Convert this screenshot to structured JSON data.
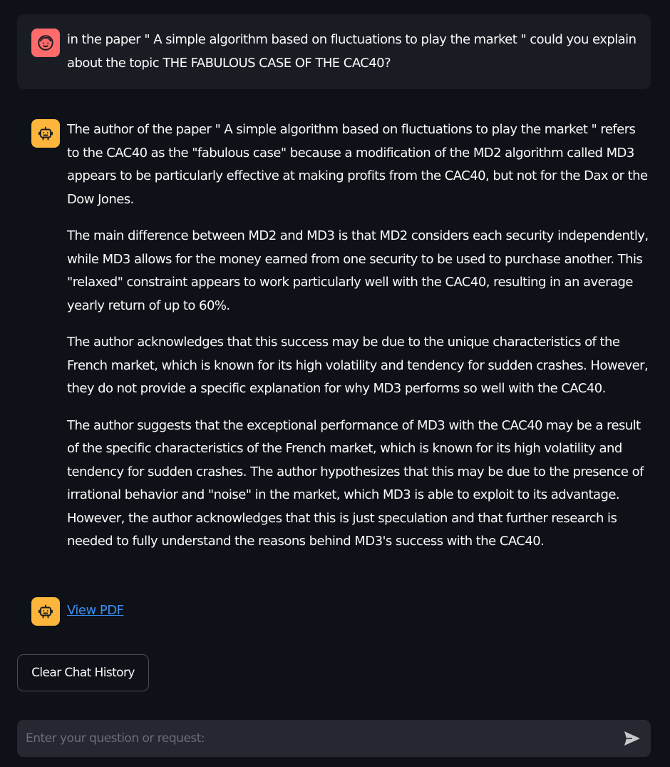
{
  "user_message": {
    "icon": "user-face-icon",
    "text": "in the paper \" A simple algorithm based on fluctuations to play the market \" could you explain about the topic THE FABULOUS CASE OF THE CAC40?"
  },
  "assistant_message": {
    "icon": "robot-icon",
    "paragraphs": [
      "The author of the paper \" A simple algorithm based on fluctuations to play the market \" refers to the CAC40 as the \"fabulous case\" because a modification of the MD2 algorithm called MD3 appears to be particularly effective at making profits from the CAC40, but not for the Dax or the Dow Jones.",
      "The main difference between MD2 and MD3 is that MD2 considers each security independently, while MD3 allows for the money earned from one security to be used to purchase another. This \"relaxed\" constraint appears to work particularly well with the CAC40, resulting in an average yearly return of up to 60%.",
      "The author acknowledges that this success may be due to the unique characteristics of the French market, which is known for its high volatility and tendency for sudden crashes. However, they do not provide a specific explanation for why MD3 performs so well with the CAC40.",
      "The author suggests that the exceptional performance of MD3 with the CAC40 may be a result of the specific characteristics of the French market, which is known for its high volatility and tendency for sudden crashes. The author hypothesizes that this may be due to the presence of irrational behavior and \"noise\" in the market, which MD3 is able to exploit to its advantage. However, the author acknowledges that this is just speculation and that further research is needed to fully understand the reasons behind MD3's success with the CAC40."
    ]
  },
  "pdf_message": {
    "icon": "robot-icon",
    "link_label": "View PDF"
  },
  "clear_button_label": "Clear Chat History",
  "chat_input": {
    "value": "",
    "placeholder": "Enter your question or request:",
    "send_icon": "send-icon"
  },
  "colors": {
    "background": "#0e1117",
    "user_bubble": "#1a1c24",
    "user_avatar": "#ff6b6b",
    "bot_avatar": "#fdb63b",
    "link": "#3a8ff5",
    "input_bg": "#262730"
  }
}
